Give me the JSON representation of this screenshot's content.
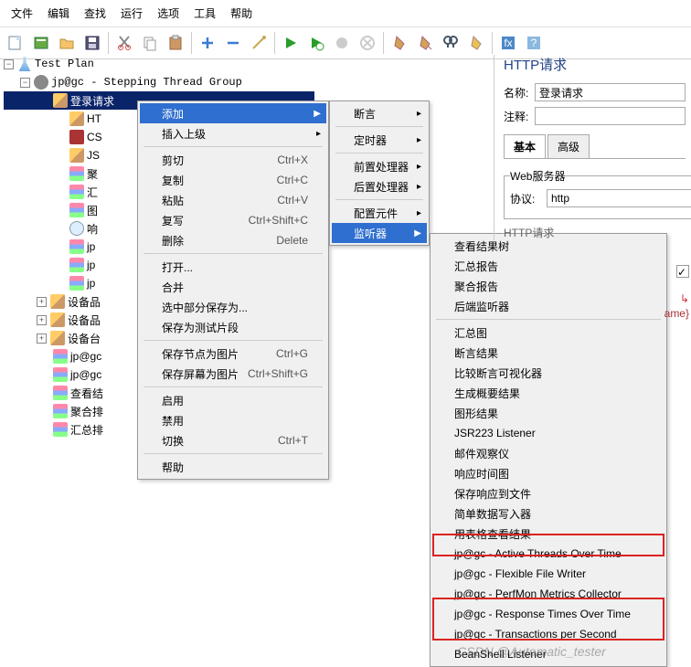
{
  "menubar": [
    "文件",
    "编辑",
    "查找",
    "运行",
    "选项",
    "工具",
    "帮助"
  ],
  "tree": {
    "root": "Test Plan",
    "group": "jp@gc - Stepping Thread Group",
    "items": [
      "登录请求",
      "HT",
      "CS",
      "JS",
      "聚",
      "汇",
      "图",
      "响",
      "jp",
      "jp",
      "jp",
      "设备品",
      "设备品",
      "设备台",
      "jp@gc",
      "jp@gc",
      "查看结",
      "聚合排",
      "汇总排"
    ]
  },
  "context_menu": {
    "add": "添加",
    "insert_parent": "插入上级",
    "cut": "剪切",
    "cut_k": "Ctrl+X",
    "copy": "复制",
    "copy_k": "Ctrl+C",
    "paste": "粘贴",
    "paste_k": "Ctrl+V",
    "duplicate": "复写",
    "duplicate_k": "Ctrl+Shift+C",
    "delete": "删除",
    "delete_k": "Delete",
    "open": "打开...",
    "merge": "合并",
    "save_selection": "选中部分保存为...",
    "save_fragment": "保存为测试片段",
    "save_node_img": "保存节点为图片",
    "save_node_img_k": "Ctrl+G",
    "save_screen_img": "保存屏幕为图片",
    "save_screen_img_k": "Ctrl+Shift+G",
    "enable": "启用",
    "disable": "禁用",
    "toggle": "切换",
    "toggle_k": "Ctrl+T",
    "help": "帮助"
  },
  "submenu": {
    "assertion": "断言",
    "timer": "定时器",
    "preproc": "前置处理器",
    "postproc": "后置处理器",
    "config": "配置元件",
    "listener": "监听器"
  },
  "listeners": [
    "查看结果树",
    "汇总报告",
    "聚合报告",
    "后端监听器",
    "汇总图",
    "断言结果",
    "比较断言可视化器",
    "生成概要结果",
    "图形结果",
    "JSR223 Listener",
    "邮件观察仪",
    "响应时间图",
    "保存响应到文件",
    "简单数据写入器",
    "用表格查看结果",
    "jp@gc - Active Threads Over Time",
    "jp@gc - Flexible File Writer",
    "jp@gc - PerfMon Metrics Collector",
    "jp@gc - Response Times Over Time",
    "jp@gc - Transactions per Second",
    "BeanShell Listener"
  ],
  "panel": {
    "title": "HTTP请求",
    "name_label": "名称:",
    "name_value": "登录请求",
    "comment_label": "注释:",
    "comment_value": "",
    "tab_basic": "基本",
    "tab_adv": "高级",
    "group_title": "Web服务器",
    "proto_label": "协议:",
    "proto_value": "http",
    "sub": "HTTP请求"
  },
  "snippet": "ame}",
  "watermark": "CSDN @Automatic_tester"
}
